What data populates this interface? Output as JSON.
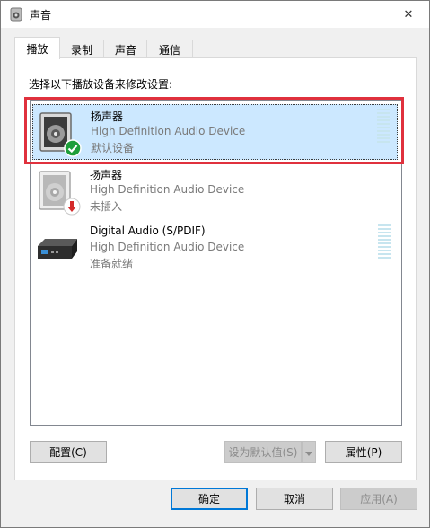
{
  "window": {
    "title": "声音",
    "close_glyph": "✕"
  },
  "tabs": [
    {
      "label": "播放",
      "active": true
    },
    {
      "label": "录制",
      "active": false
    },
    {
      "label": "声音",
      "active": false
    },
    {
      "label": "通信",
      "active": false
    }
  ],
  "panel": {
    "instruction": "选择以下播放设备来修改设置:"
  },
  "devices": [
    {
      "name": "扬声器",
      "description": "High Definition Audio Device",
      "status": "默认设备",
      "icon": "speaker-icon",
      "badge": "default-check-icon",
      "selected": true
    },
    {
      "name": "扬声器",
      "description": "High Definition Audio Device",
      "status": "未插入",
      "icon": "speaker-icon",
      "badge": "unplugged-arrow-icon",
      "selected": false
    },
    {
      "name": "Digital Audio (S/PDIF)",
      "description": "High Definition Audio Device",
      "status": "准备就绪",
      "icon": "digital-output-icon",
      "badge": "",
      "selected": false
    }
  ],
  "buttons": {
    "configure": "配置(C)",
    "set_default": "设为默认值(S)",
    "properties": "属性(P)",
    "ok": "确定",
    "cancel": "取消",
    "apply": "应用(A)"
  },
  "colors": {
    "selection": "#cce8ff",
    "highlight_border": "#e0313d",
    "default_badge": "#1e9e3a",
    "unplugged_badge": "#d42a2a",
    "meter": "#c7e5ef"
  }
}
